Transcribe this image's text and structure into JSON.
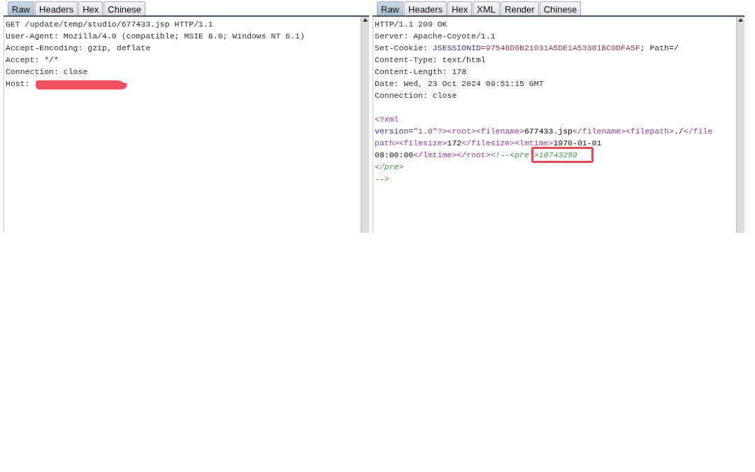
{
  "panels": [
    {
      "tabs": [
        {
          "label": "Raw",
          "selected": true
        },
        {
          "label": "Headers",
          "selected": false
        },
        {
          "label": "Hex",
          "selected": false
        },
        {
          "label": "Chinese",
          "selected": false
        }
      ],
      "lines": [
        [
          {
            "kind": "plain",
            "text": "GET /update/temp/studio/677433.jsp HTTP/1.1"
          }
        ],
        [
          {
            "kind": "plain",
            "text": "User-Agent: Mozilla/4.0 (compatible; MSIE 8.0; Windows NT 6.1)"
          }
        ],
        [
          {
            "kind": "plain",
            "text": "Accept-Encoding: gzip, deflate"
          }
        ],
        [
          {
            "kind": "plain",
            "text": "Accept: */*"
          }
        ],
        [
          {
            "kind": "plain",
            "text": "Connection: close"
          }
        ],
        [
          {
            "kind": "plain",
            "text": "Host: "
          },
          {
            "kind": "redacted"
          }
        ]
      ]
    },
    {
      "tabs": [
        {
          "label": "Raw",
          "selected": true
        },
        {
          "label": "Headers",
          "selected": false
        },
        {
          "label": "Hex",
          "selected": false
        },
        {
          "label": "XML",
          "selected": false
        },
        {
          "label": "Render",
          "selected": false
        },
        {
          "label": "Chinese",
          "selected": false
        }
      ],
      "lines": [
        [
          {
            "kind": "plain",
            "text": "HTTP/1.1 200 OK"
          }
        ],
        [
          {
            "kind": "plain",
            "text": "Server: Apache-Coyote/1.1"
          }
        ],
        [
          {
            "kind": "plain",
            "text": "Set-Cookie: "
          },
          {
            "kind": "name",
            "text": "JSESSIONID"
          },
          {
            "kind": "value",
            "text": "=97548D0B21031A5DE1A53381BC0DFA5F"
          },
          {
            "kind": "plain",
            "text": "; Path=/"
          }
        ],
        [
          {
            "kind": "plain",
            "text": "Content-Type: text/html"
          }
        ],
        [
          {
            "kind": "plain",
            "text": "Content-Length: 178"
          }
        ],
        [
          {
            "kind": "plain",
            "text": "Date: Wed, 23 Oct 2024 09:51:15 GMT"
          }
        ],
        [
          {
            "kind": "plain",
            "text": "Connection: close"
          }
        ]
      ],
      "body": [
        [
          {
            "kind": "tag",
            "text": "<?xml"
          }
        ],
        [
          {
            "kind": "name",
            "text": "version="
          },
          {
            "kind": "value",
            "text": "\"1.0\""
          },
          {
            "kind": "tag",
            "text": "?><root><filename>"
          },
          {
            "kind": "text",
            "text": "677433.jsp"
          },
          {
            "kind": "tag",
            "text": "</filename><filepath>"
          },
          {
            "kind": "text",
            "text": "./"
          },
          {
            "kind": "tag",
            "text": "</file"
          }
        ],
        [
          {
            "kind": "tag",
            "text": "path><filesize>"
          },
          {
            "kind": "text",
            "text": "172"
          },
          {
            "kind": "tag",
            "text": "</filesize><lmtime>"
          },
          {
            "kind": "text",
            "text": "1970-01-01"
          }
        ],
        [
          {
            "kind": "text",
            "text": "08:00:00"
          },
          {
            "kind": "tag",
            "text": "</lmtime></root>"
          },
          {
            "kind": "comment",
            "text": "<!--<pre"
          },
          {
            "kind": "comment",
            "text": ">10743259",
            "highlighted": true
          }
        ],
        [
          {
            "kind": "comment",
            "text": "</pre>"
          }
        ],
        [
          {
            "kind": "comment",
            "text": "-->"
          }
        ]
      ]
    }
  ]
}
